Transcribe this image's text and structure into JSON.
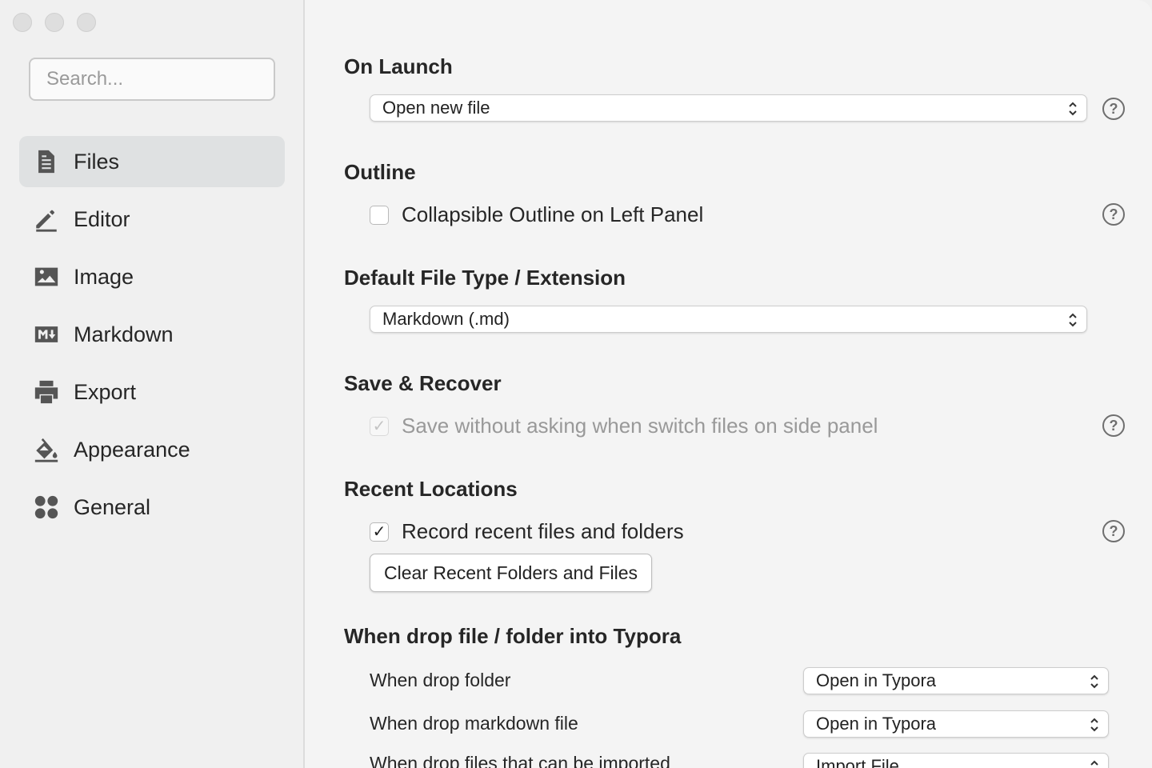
{
  "sidebar": {
    "search_placeholder": "Search...",
    "items": [
      {
        "label": "Files",
        "icon": "file-icon",
        "active": true
      },
      {
        "label": "Editor",
        "icon": "pencil-icon",
        "active": false
      },
      {
        "label": "Image",
        "icon": "image-icon",
        "active": false
      },
      {
        "label": "Markdown",
        "icon": "markdown-icon",
        "active": false
      },
      {
        "label": "Export",
        "icon": "printer-icon",
        "active": false
      },
      {
        "label": "Appearance",
        "icon": "paint-bucket-icon",
        "active": false
      },
      {
        "label": "General",
        "icon": "grid-icon",
        "active": false
      }
    ]
  },
  "sections": {
    "on_launch": {
      "title": "On Launch",
      "select_value": "Open new file"
    },
    "outline": {
      "title": "Outline",
      "checkbox_label": "Collapsible Outline on Left Panel",
      "checked": false
    },
    "default_type": {
      "title": "Default File Type / Extension",
      "select_value": "Markdown (.md)"
    },
    "save_recover": {
      "title": "Save & Recover",
      "checkbox_label": "Save without asking when switch files on side panel",
      "checked": true,
      "disabled": true
    },
    "recent": {
      "title": "Recent Locations",
      "checkbox_label": "Record recent files and folders",
      "checked": true,
      "button_label": "Clear Recent Folders and Files"
    },
    "drop": {
      "title": "When drop file / folder into Typora",
      "rows": [
        {
          "label": "When drop folder",
          "value": "Open in Typora"
        },
        {
          "label": "When drop markdown file",
          "value": "Open in Typora"
        },
        {
          "label": "When drop files that can be imported",
          "value": "Import File"
        }
      ]
    }
  },
  "help_glyph": "?",
  "check_glyph": "✓",
  "colors": {
    "active_item_bg": "#dfe1e2",
    "sidebar_bg": "#f0f0f0",
    "content_bg": "#f4f4f4"
  }
}
